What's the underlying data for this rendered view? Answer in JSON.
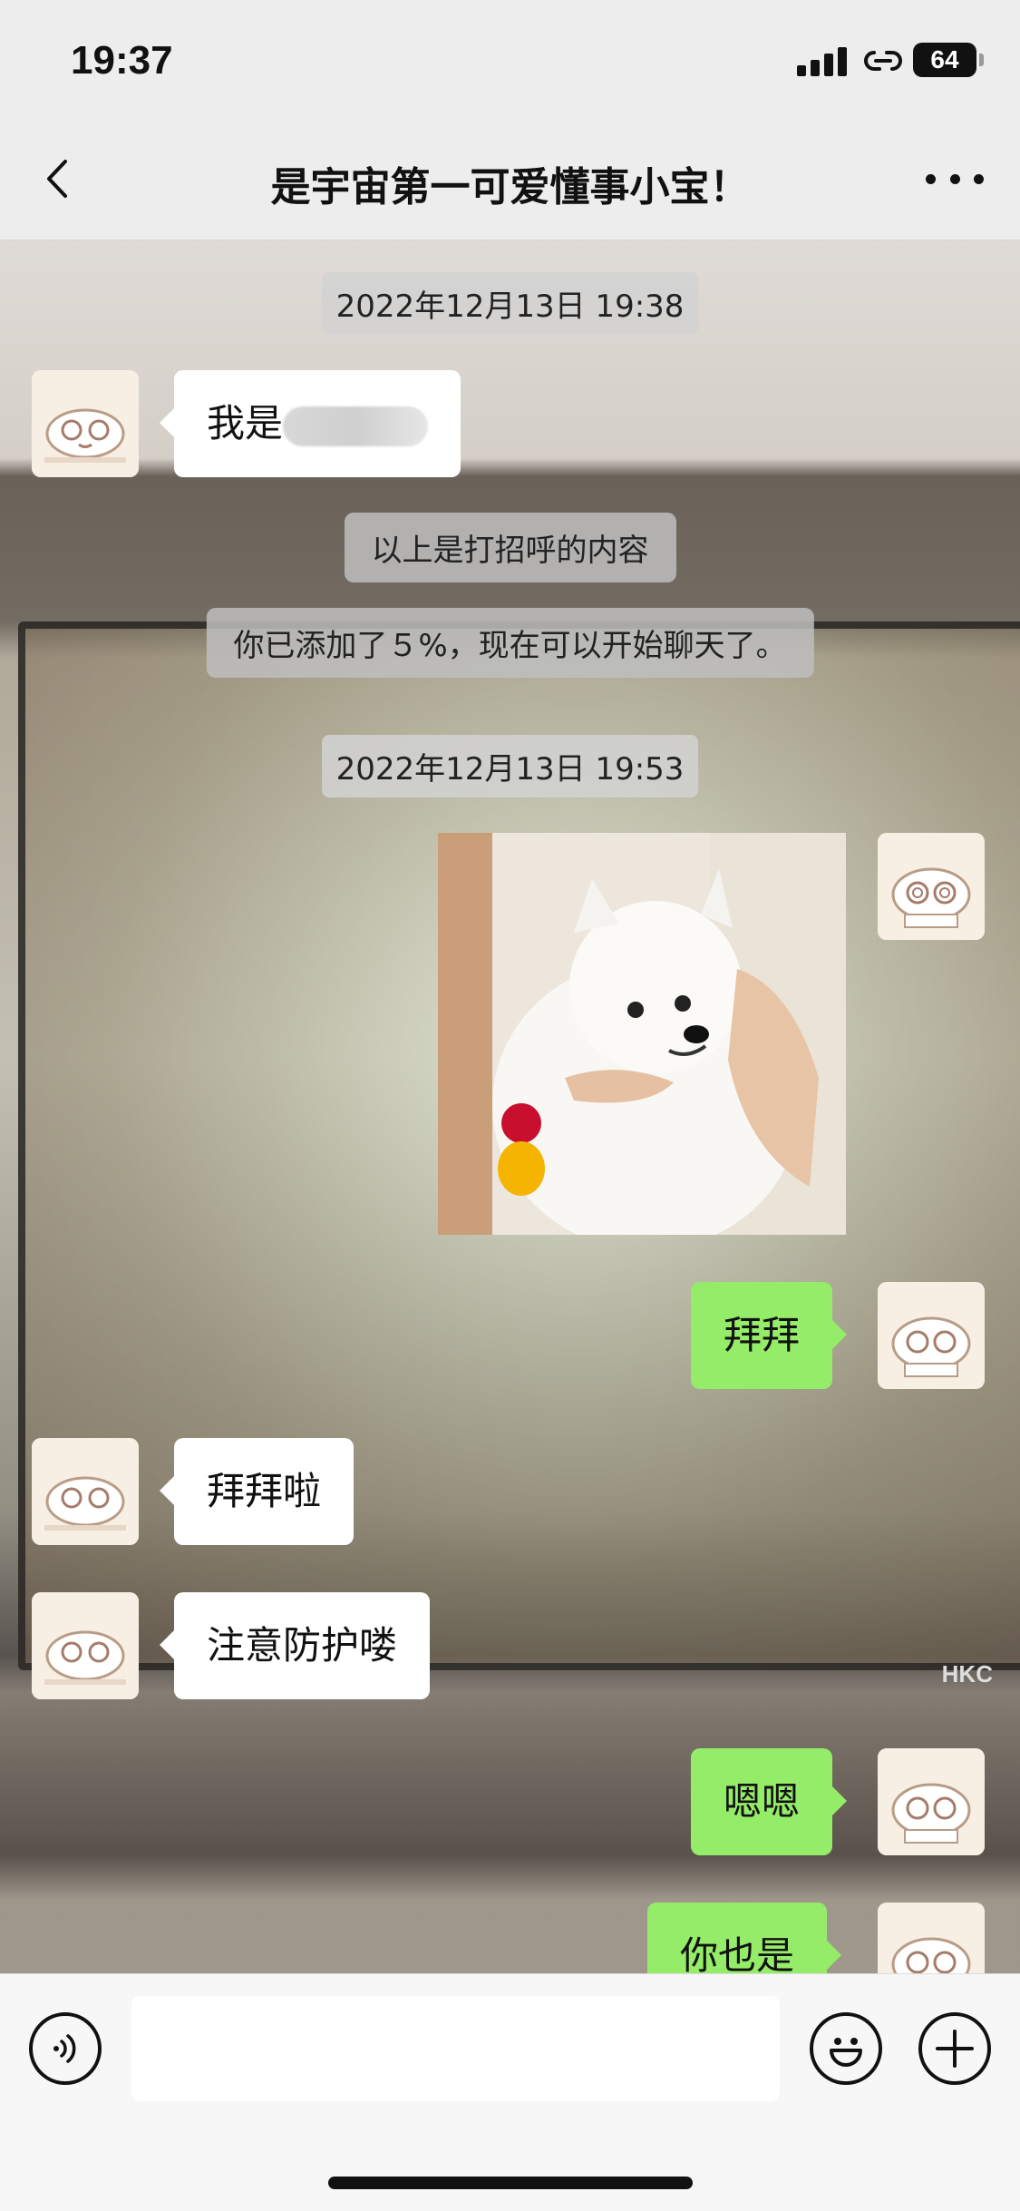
{
  "status": {
    "time": "19:37",
    "battery": "64"
  },
  "header": {
    "title": "是宇宙第一可爱懂事小宝！"
  },
  "messages": {
    "stamp1": "2022年12月13日 19:38",
    "intro_prefix": "我是",
    "sys_greeting": "以上是打招呼的内容",
    "sys_added": "你已添加了５%，现在可以开始聊天了。",
    "stamp2": "2022年12月13日 19:53",
    "out_bye": "拜拜",
    "in_bye": "拜拜啦",
    "in_care": "注意防护喽",
    "out_enen": "嗯嗯",
    "out_you_too": "你也是"
  },
  "input": {
    "value": "",
    "placeholder": ""
  },
  "colors": {
    "outgoing_bubble": "#95ec69",
    "incoming_bubble": "#ffffff",
    "bar_bg": "#ededed"
  }
}
